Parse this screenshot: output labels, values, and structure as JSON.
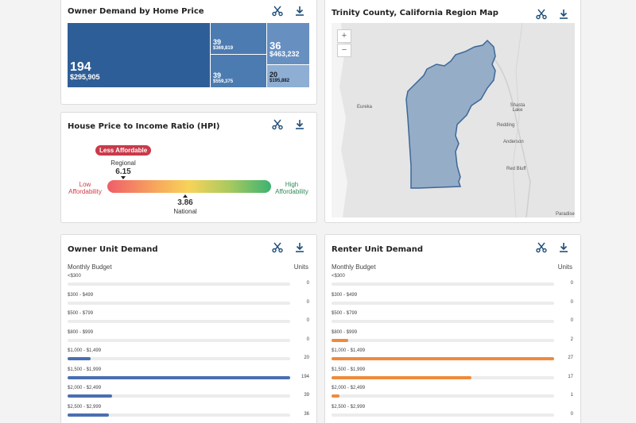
{
  "owner_demand": {
    "title": "Owner Demand by Home Price",
    "tiles": [
      {
        "count": "194",
        "price": "$295,905"
      },
      {
        "count": "39",
        "price": "$369,819"
      },
      {
        "count": "39",
        "price": "$559,375"
      },
      {
        "count": "36",
        "price": "$463,232"
      },
      {
        "count": "20",
        "price": "$195,882"
      }
    ],
    "colors": [
      "#2e5e97",
      "#4b7bb0",
      "#4b7bb0",
      "#6790c1",
      "#8faed3"
    ]
  },
  "hpi": {
    "title": "House Price to Income Ratio (HPI)",
    "badge": "Less Affordable",
    "regional_label": "Regional",
    "regional_value": "6.15",
    "national_value": "3.86",
    "national_label": "National",
    "low_label_1": "Low",
    "low_label_2": "Affordability",
    "high_label_1": "High",
    "high_label_2": "Affordability"
  },
  "map": {
    "title": "Trinity County, California Region Map",
    "zoom_in": "+",
    "zoom_out": "−",
    "cities": [
      "Eureka",
      "Redding",
      "Anderson",
      "Red Bluff",
      "Shasta Lake",
      "Paradise"
    ]
  },
  "owner_units": {
    "title": "Owner Unit Demand",
    "budget_label": "Monthly Budget",
    "units_label": "Units",
    "bar_color": "#4a6fb0",
    "max": 194,
    "rows": [
      {
        "label": "<$300",
        "value": 0
      },
      {
        "label": "$300 - $499",
        "value": 0
      },
      {
        "label": "$500 - $799",
        "value": 0
      },
      {
        "label": "$800 - $999",
        "value": 0
      },
      {
        "label": "$1,000 - $1,499",
        "value": 20
      },
      {
        "label": "$1,500 - $1,999",
        "value": 194
      },
      {
        "label": "$2,000 - $2,499",
        "value": 39
      },
      {
        "label": "$2,500 - $2,999",
        "value": 36
      }
    ]
  },
  "renter_units": {
    "title": "Renter Unit Demand",
    "budget_label": "Monthly Budget",
    "units_label": "Units",
    "bar_color": "#f08a3c",
    "max": 27,
    "rows": [
      {
        "label": "<$300",
        "value": 0
      },
      {
        "label": "$300 - $499",
        "value": 0
      },
      {
        "label": "$500 - $799",
        "value": 0
      },
      {
        "label": "$800 - $999",
        "value": 2
      },
      {
        "label": "$1,000 - $1,499",
        "value": 27
      },
      {
        "label": "$1,500 - $1,999",
        "value": 17
      },
      {
        "label": "$2,000 - $2,499",
        "value": 1
      },
      {
        "label": "$2,500 - $2,999",
        "value": 0
      }
    ]
  }
}
